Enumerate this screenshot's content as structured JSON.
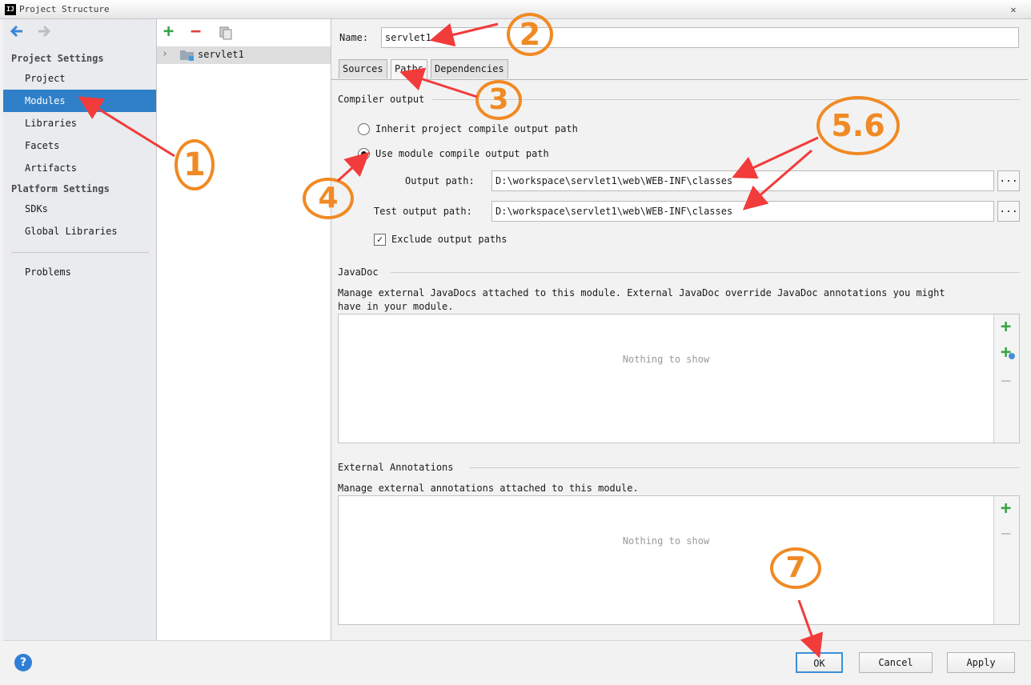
{
  "window": {
    "title": "Project Structure",
    "app_icon": "IJ",
    "close": "✕"
  },
  "nav": {
    "back_icon": "arrow-left-icon",
    "forward_icon": "arrow-right-icon",
    "project_settings_header": "Project Settings",
    "project_items": [
      "Project",
      "Modules",
      "Libraries",
      "Facets",
      "Artifacts"
    ],
    "platform_settings_header": "Platform Settings",
    "platform_items": [
      "SDKs",
      "Global Libraries"
    ],
    "problems": "Problems",
    "selected": "Modules"
  },
  "modules": {
    "toolbar": [
      "add-icon",
      "remove-icon",
      "copy-icon"
    ],
    "tree_item": "servlet1"
  },
  "editor": {
    "name_label": "Name:",
    "name_value": "servlet1",
    "tabs": [
      "Sources",
      "Paths",
      "Dependencies"
    ],
    "active_tab": "Paths",
    "compiler_output": {
      "title": "Compiler output",
      "inherit_label": "Inherit project compile output path",
      "use_module_label": "Use module compile output path",
      "selected": "use_module",
      "output_path_label": "Output path:",
      "output_path_value": "D:\\workspace\\servlet1\\web\\WEB-INF\\classes",
      "test_output_path_label": "Test output path:",
      "test_output_path_value": "D:\\workspace\\servlet1\\web\\WEB-INF\\classes",
      "browse_label": "...",
      "exclude_label": "Exclude output paths",
      "exclude_checked": true,
      "check_mark": "✓"
    },
    "javadoc": {
      "title": "JavaDoc",
      "desc_line1": "Manage external JavaDocs attached to this module. External JavaDoc override JavaDoc annotations you might",
      "desc_line2": "have in your module.",
      "empty": "Nothing to show"
    },
    "annotations": {
      "title": "External Annotations",
      "desc": "Manage external annotations attached to this module.",
      "empty": "Nothing to show"
    }
  },
  "footer": {
    "help": "?",
    "ok": "OK",
    "cancel": "Cancel",
    "apply": "Apply"
  },
  "annotations_overlay": [
    "1",
    "2",
    "3",
    "4",
    "5.6",
    "7"
  ],
  "colors": {
    "selection": "#2f7fc8",
    "annotation": "#f08a24",
    "arrow": "#f23b3b",
    "add": "#3aa447"
  }
}
